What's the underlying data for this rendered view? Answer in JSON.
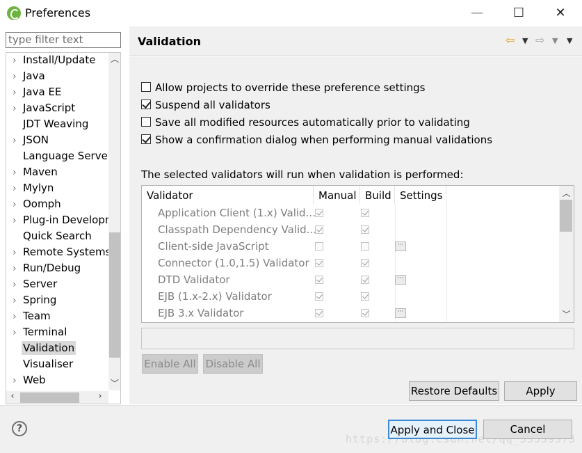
{
  "window": {
    "title": "Preferences",
    "minimize_glyph": "—",
    "maximize_glyph": "☐",
    "close_glyph": "✕"
  },
  "sidebar": {
    "filter_placeholder": "type filter text",
    "items": [
      {
        "label": "Install/Update",
        "expandable": true
      },
      {
        "label": "Java",
        "expandable": true
      },
      {
        "label": "Java EE",
        "expandable": true
      },
      {
        "label": "JavaScript",
        "expandable": true
      },
      {
        "label": "JDT Weaving",
        "expandable": false
      },
      {
        "label": "JSON",
        "expandable": true
      },
      {
        "label": "Language Server",
        "expandable": false
      },
      {
        "label": "Maven",
        "expandable": true
      },
      {
        "label": "Mylyn",
        "expandable": true
      },
      {
        "label": "Oomph",
        "expandable": true
      },
      {
        "label": "Plug-in Development",
        "expandable": true
      },
      {
        "label": "Quick Search",
        "expandable": false
      },
      {
        "label": "Remote Systems",
        "expandable": true
      },
      {
        "label": "Run/Debug",
        "expandable": true
      },
      {
        "label": "Server",
        "expandable": true
      },
      {
        "label": "Spring",
        "expandable": true
      },
      {
        "label": "Team",
        "expandable": true
      },
      {
        "label": "Terminal",
        "expandable": true
      },
      {
        "label": "Validation",
        "expandable": false,
        "selected": true
      },
      {
        "label": "Visualiser",
        "expandable": false
      },
      {
        "label": "Web",
        "expandable": true
      }
    ]
  },
  "page": {
    "title": "Validation",
    "options": [
      {
        "label": "Allow projects to override these preference settings",
        "checked": false
      },
      {
        "label": "Suspend all validators",
        "checked": true
      },
      {
        "label": "Save all modified resources automatically prior to validating",
        "checked": false
      },
      {
        "label": "Show a confirmation dialog when performing manual validations",
        "checked": true
      }
    ],
    "table_caption": "The selected validators will run when validation is performed:",
    "table": {
      "columns": [
        "Validator",
        "Manual",
        "Build",
        "Settings"
      ],
      "rows": [
        {
          "name": "Application Client (1.x) Valid...",
          "manual": true,
          "build": true,
          "settings": false
        },
        {
          "name": "Classpath Dependency Valid...",
          "manual": true,
          "build": true,
          "settings": false
        },
        {
          "name": "Client-side JavaScript",
          "manual": false,
          "build": false,
          "settings": true
        },
        {
          "name": "Connector (1.0,1.5) Validator",
          "manual": true,
          "build": true,
          "settings": false
        },
        {
          "name": "DTD Validator",
          "manual": true,
          "build": true,
          "settings": true
        },
        {
          "name": "EJB (1.x-2.x) Validator",
          "manual": true,
          "build": true,
          "settings": false
        },
        {
          "name": "EJB 3.x Validator",
          "manual": true,
          "build": true,
          "settings": true
        }
      ]
    },
    "enable_all": "Enable All",
    "disable_all": "Disable All",
    "restore_defaults": "Restore Defaults",
    "apply": "Apply"
  },
  "footer": {
    "help_glyph": "?",
    "apply_and_close": "Apply and Close",
    "cancel": "Cancel",
    "watermark": "https://blog.csdn.net/qq_33559573"
  },
  "colors": {
    "accent_focus": "#3c8ad6",
    "selected_item_bg": "#d9d9d9",
    "back_arrow": "#d9a326",
    "spring_logo": "#6db33f"
  }
}
